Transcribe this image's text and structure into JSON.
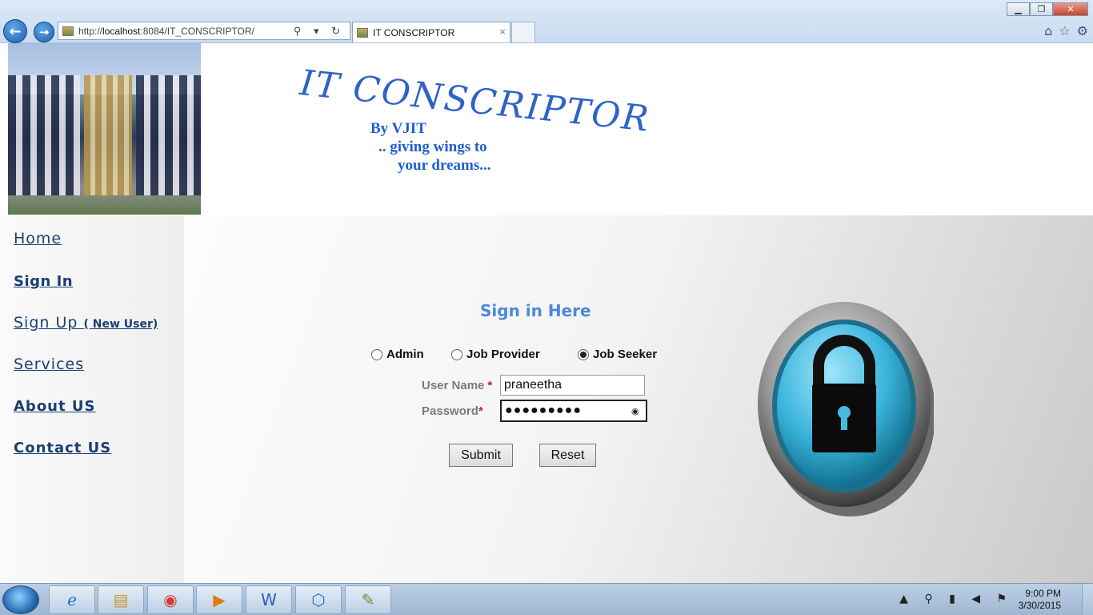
{
  "browser": {
    "url_prefix": "http://",
    "url_host": "localhost",
    "url_path": ":8084/IT_CONSCRIPTOR/",
    "tab_title": "IT CONSCRIPTOR",
    "tab_close": "×",
    "back_icon": "back-arrow-icon",
    "forward_icon": "forward-arrow-icon",
    "addr_tools": "⚲ ▾ ↻",
    "win_min": "▁",
    "win_max": "❐",
    "win_close": "✕",
    "right_tools": [
      "⌂",
      "☆",
      "⚙"
    ]
  },
  "header": {
    "logo": "IT CONSCRIPTOR",
    "tagline_1": "By VJIT",
    "tagline_2": ".. giving wings to",
    "tagline_3": "your dreams..."
  },
  "sidebar": {
    "home": "Home",
    "sign_in": "Sign In",
    "sign_up": "Sign Up",
    "new_user": "( New User)",
    "services": "Services",
    "about": "About US",
    "contact": "Contact US"
  },
  "form": {
    "title": "Sign in Here",
    "role_admin": "Admin",
    "role_provider": "Job Provider",
    "role_seeker": "Job Seeker",
    "selected_role": "Job Seeker",
    "username_label": "User Name",
    "password_label": "Password",
    "required_mark": "*",
    "username_value": "praneetha",
    "password_value": "●●●●●●●●●",
    "submit": "Submit",
    "reset": "Reset"
  },
  "taskbar": {
    "time": "9:00 PM",
    "date": "3/30/2015",
    "tray_icons": "▲ ⚲ ▮ ◀ ⚑"
  },
  "colors": {
    "title_blue": "#4c8ad8",
    "nav_blue": "#1b3f73",
    "logo_blue": "#2e63c7",
    "lock_cyan": "#46b9df"
  }
}
